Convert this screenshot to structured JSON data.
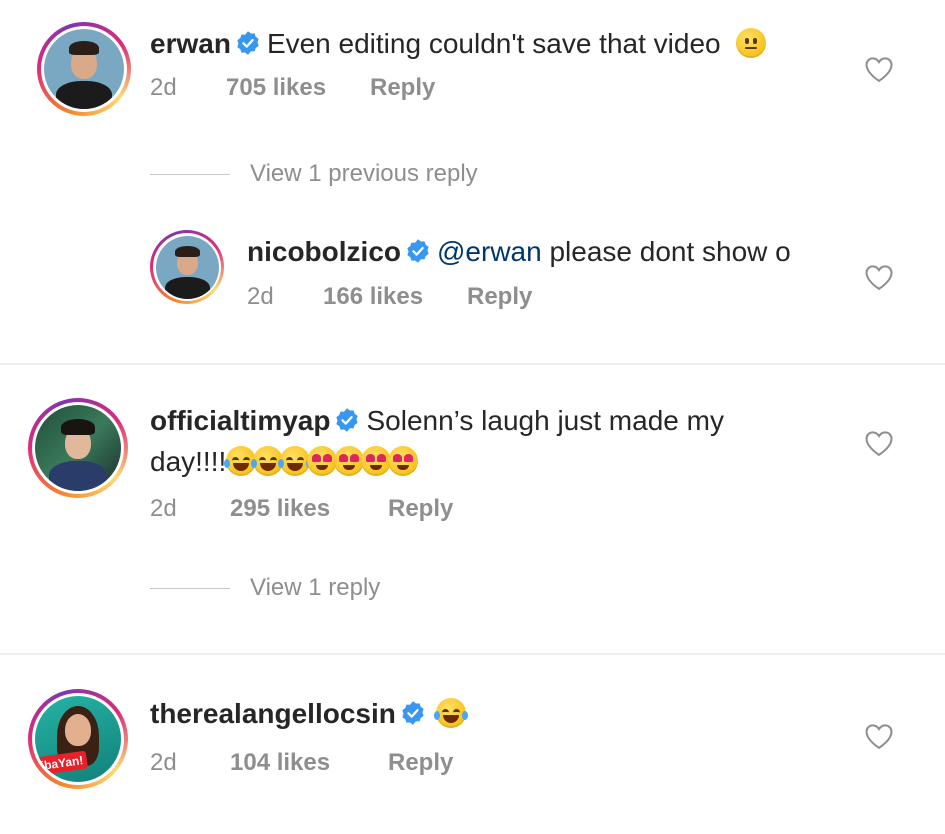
{
  "comments": [
    {
      "username": "erwan",
      "text": "Even editing couldn't save that video",
      "emoji": [
        "neutral"
      ],
      "age": "2d",
      "likes": "705 likes",
      "reply_label": "Reply",
      "view_replies": "View 1 previous reply"
    },
    {
      "username": "nicobolzico",
      "mention": "@erwan",
      "text": "please dont show o",
      "age": "2d",
      "likes": "166 likes",
      "reply_label": "Reply"
    },
    {
      "username": "officialtimyap",
      "text": "Solenn’s laugh just made my",
      "text2": "day!!!!",
      "emoji": [
        "laugh",
        "laugh",
        "laugh",
        "heart-eyes",
        "heart-eyes",
        "heart-eyes",
        "heart-eyes"
      ],
      "age": "2d",
      "likes": "295 likes",
      "reply_label": "Reply",
      "view_replies": "View 1 reply"
    },
    {
      "username": "therealangellocsin",
      "emoji": [
        "laugh"
      ],
      "age": "2d",
      "likes": "104 likes",
      "reply_label": "Reply",
      "avatar_badge": "ibaYan!"
    }
  ],
  "colors": {
    "verified": "#3897f0",
    "meta": "#8e8e8e",
    "mention": "#00376b"
  },
  "icons": {
    "verified": "verified-badge-icon",
    "like": "heart-outline-icon"
  }
}
